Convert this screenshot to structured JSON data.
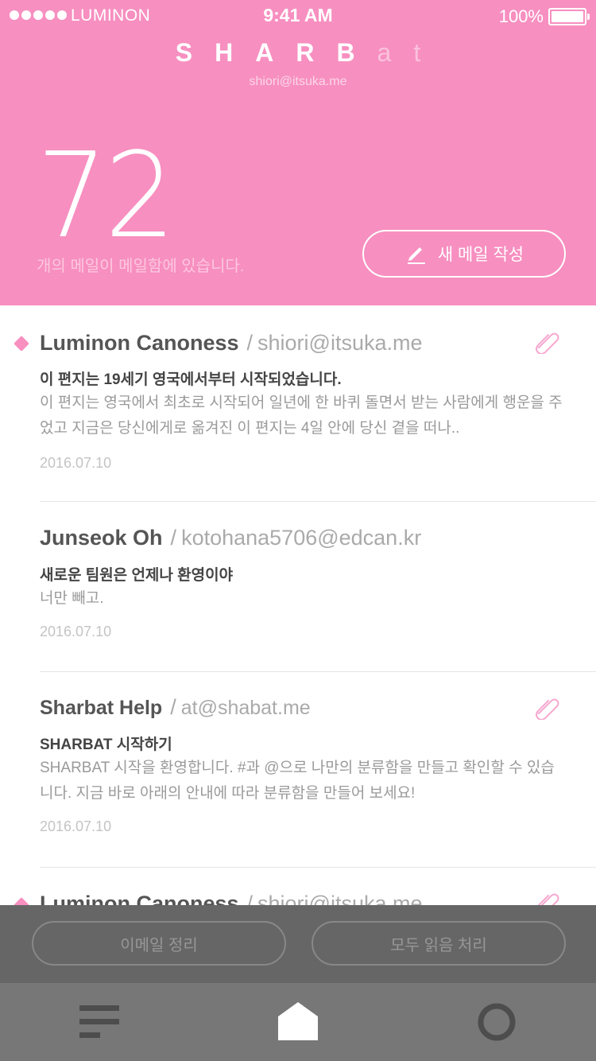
{
  "status_bar": {
    "carrier": "LUMINON",
    "time": "9:41 AM",
    "battery": "100%"
  },
  "header": {
    "logo_bold": "SHARB",
    "logo_light": "at",
    "account_email": "shiori@itsuka.me",
    "mail_count": "72",
    "count_caption": "개의 메일이 메일함에 있습니다.",
    "compose_label": "새 메일 작성",
    "accent_color": "#f78fc0"
  },
  "mails": [
    {
      "sender": "Luminon Canoness",
      "separator": "/",
      "email": "shiori@itsuka.me",
      "subject": "이 편지는 19세기 영국에서부터 시작되었습니다.",
      "preview": "이 편지는 영국에서 최초로 시작되어 일년에 한 바퀴 돌면서 받는 사람에게 행운을 주었고 지금은 당신에게로 옮겨진 이 편지는 4일 안에 당신 곁을 떠나..",
      "date": "2016.07.10",
      "unread": true,
      "attachment": true
    },
    {
      "sender": "Junseok Oh",
      "separator": "/",
      "email": "kotohana5706@edcan.kr",
      "subject": "새로운 팀원은 언제나 환영이야",
      "preview": "너만 빼고.",
      "date": "2016.07.10",
      "unread": false,
      "attachment": false
    },
    {
      "sender": "Sharbat Help",
      "separator": "/",
      "email": "at@shabat.me",
      "subject": "SHARBAT 시작하기",
      "preview": "SHARBAT 시작을 환영합니다. #과 @으로 나만의 분류함을 만들고 확인할 수 있습니다. 지금 바로 아래의 안내에 따라 분류함을 만들어 보세요!",
      "date": "2016.07.10",
      "unread": false,
      "attachment": true
    },
    {
      "sender": "Luminon Canoness",
      "separator": "/",
      "email": "shiori@itsuka.me",
      "unread": true,
      "attachment": true
    }
  ],
  "actions": {
    "cleanup_label": "이메일 정리",
    "mark_all_read_label": "모두 읽음 처리"
  },
  "tabs": [
    {
      "icon": "menu-icon"
    },
    {
      "icon": "home-icon",
      "active": true
    },
    {
      "icon": "circle-icon"
    }
  ]
}
